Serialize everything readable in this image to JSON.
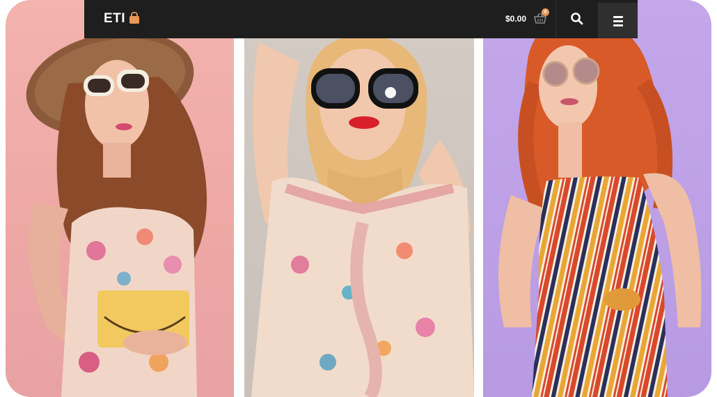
{
  "header": {
    "logo_text": "ETI",
    "cart_total": "$0.00",
    "cart_count": "0"
  },
  "icons": [
    "shopping-bag-icon",
    "basket-icon",
    "search-icon",
    "hamburger-menu-icon"
  ],
  "colors": {
    "topbar": "#1e1e1e",
    "accent": "#e99657",
    "panel_pink": "#f0b0ab",
    "panel_beige": "#cfc7c0",
    "panel_lilac": "#bfa2e7"
  }
}
